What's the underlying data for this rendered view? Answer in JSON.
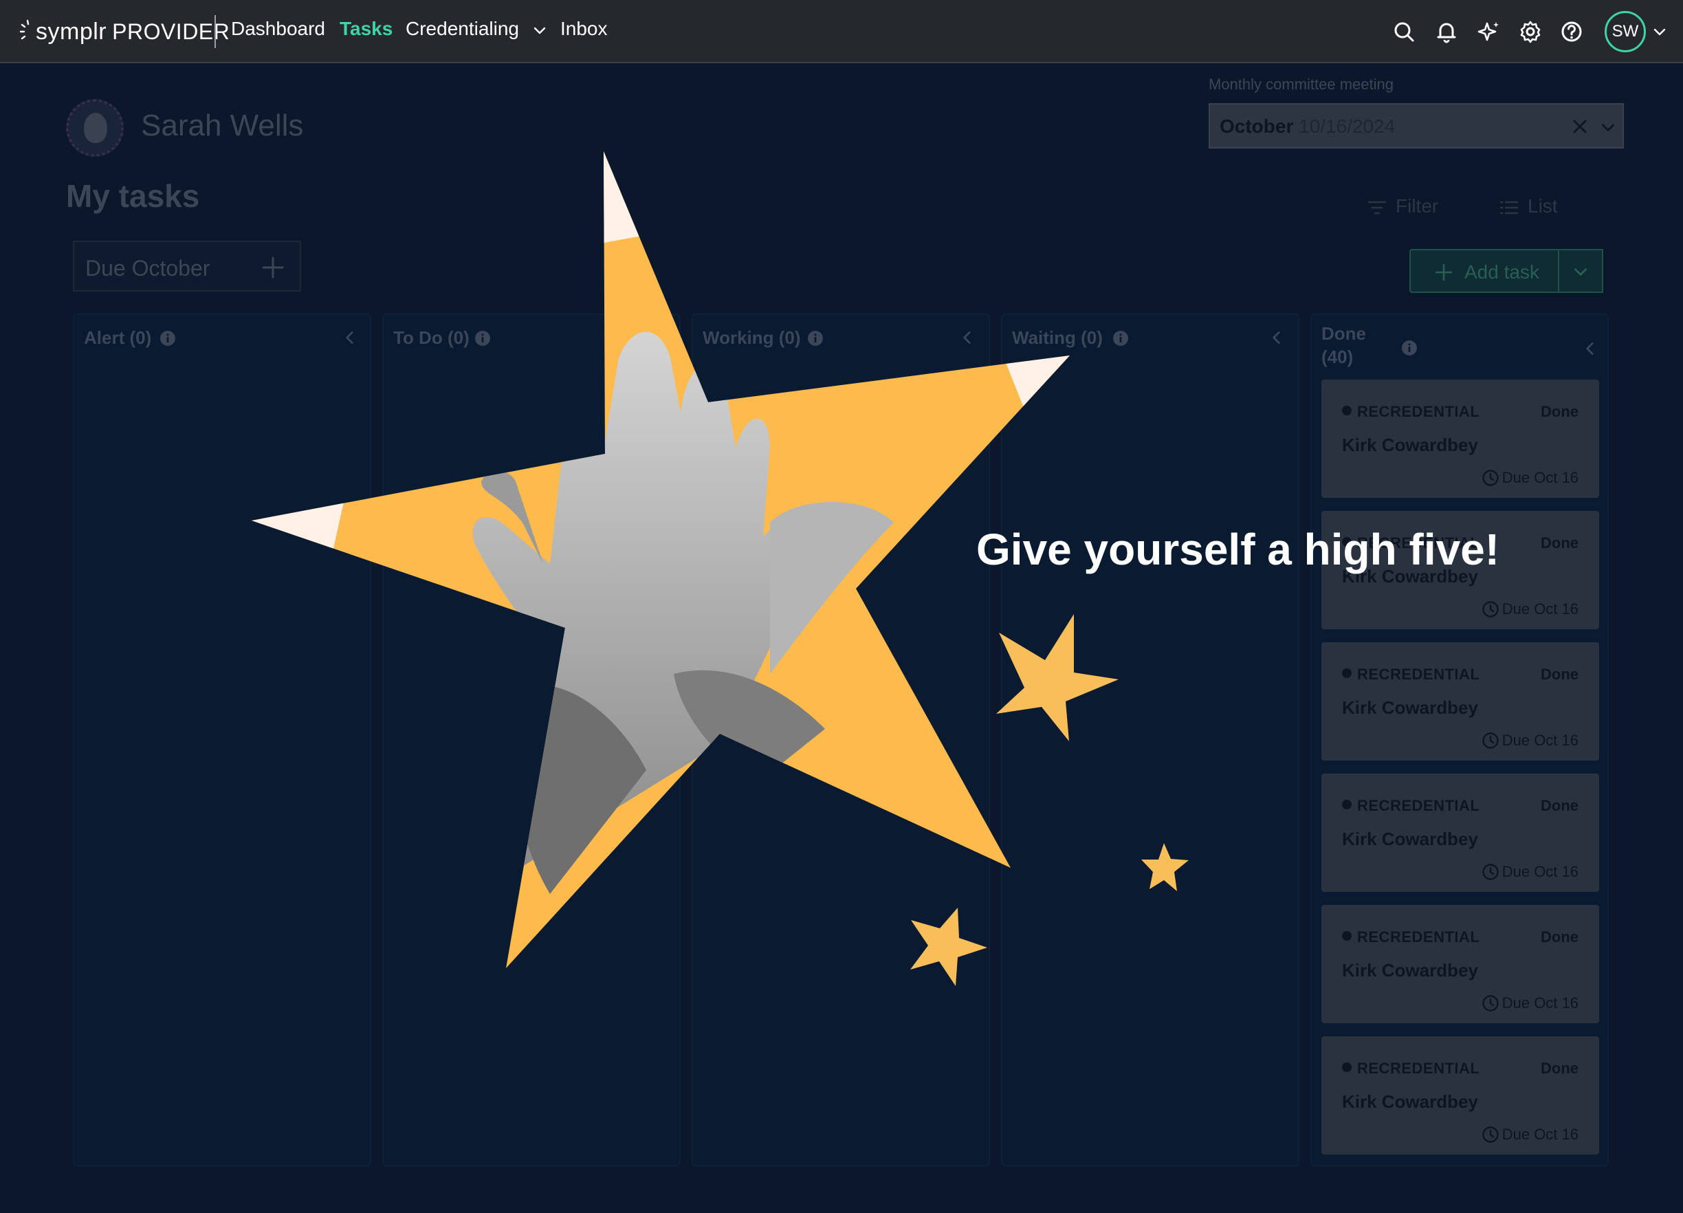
{
  "nav": {
    "brand": "symplr",
    "product": "PROVIDER",
    "items": [
      {
        "label": "Dashboard",
        "active": false
      },
      {
        "label": "Tasks",
        "active": true
      },
      {
        "label": "Credentialing",
        "active": false
      },
      {
        "label": "Inbox",
        "active": false
      }
    ],
    "icons": [
      "search-icon",
      "bell-icon",
      "sparkle-icon",
      "gear-icon",
      "help-icon"
    ],
    "user_initials": "SW",
    "active_color": "#3fd3a6"
  },
  "profile": {
    "name": "Sarah Wells"
  },
  "meeting": {
    "label": "Monthly committee meeting",
    "month": "October",
    "date": "10/16/2024"
  },
  "page": {
    "title": "My tasks",
    "filter_label": "Filter",
    "list_label": "List",
    "due_chip": "Due October",
    "add_task_label": "Add task"
  },
  "columns": [
    {
      "title": "Alert (0)"
    },
    {
      "title": "To Do (0)"
    },
    {
      "title": "Working (0)"
    },
    {
      "title": "Waiting (0)"
    },
    {
      "title_line1": "Done",
      "title_line2": "(40)"
    }
  ],
  "done_cards": [
    {
      "tag": "RECREDENTIAL",
      "status": "Done",
      "name": "Kirk Cowardbey",
      "due": "Due Oct 16"
    },
    {
      "tag": "RECREDENTIAL",
      "status": "Done",
      "name": "Kirk Cowardbey",
      "due": "Due Oct 16"
    },
    {
      "tag": "RECREDENTIAL",
      "status": "Done",
      "name": "Kirk Cowardbey",
      "due": "Due Oct 16"
    },
    {
      "tag": "RECREDENTIAL",
      "status": "Done",
      "name": "Kirk Cowardbey",
      "due": "Due Oct 16"
    },
    {
      "tag": "RECREDENTIAL",
      "status": "Done",
      "name": "Kirk Cowardbey",
      "due": "Due Oct 16"
    },
    {
      "tag": "RECREDENTIAL",
      "status": "Done",
      "name": "Kirk Cowardbey",
      "due": "Due Oct 16"
    }
  ],
  "celebration": {
    "message": "Give yourself a high five!",
    "star_color": "#fdba4d",
    "image": "high-five-hands-illustration"
  }
}
